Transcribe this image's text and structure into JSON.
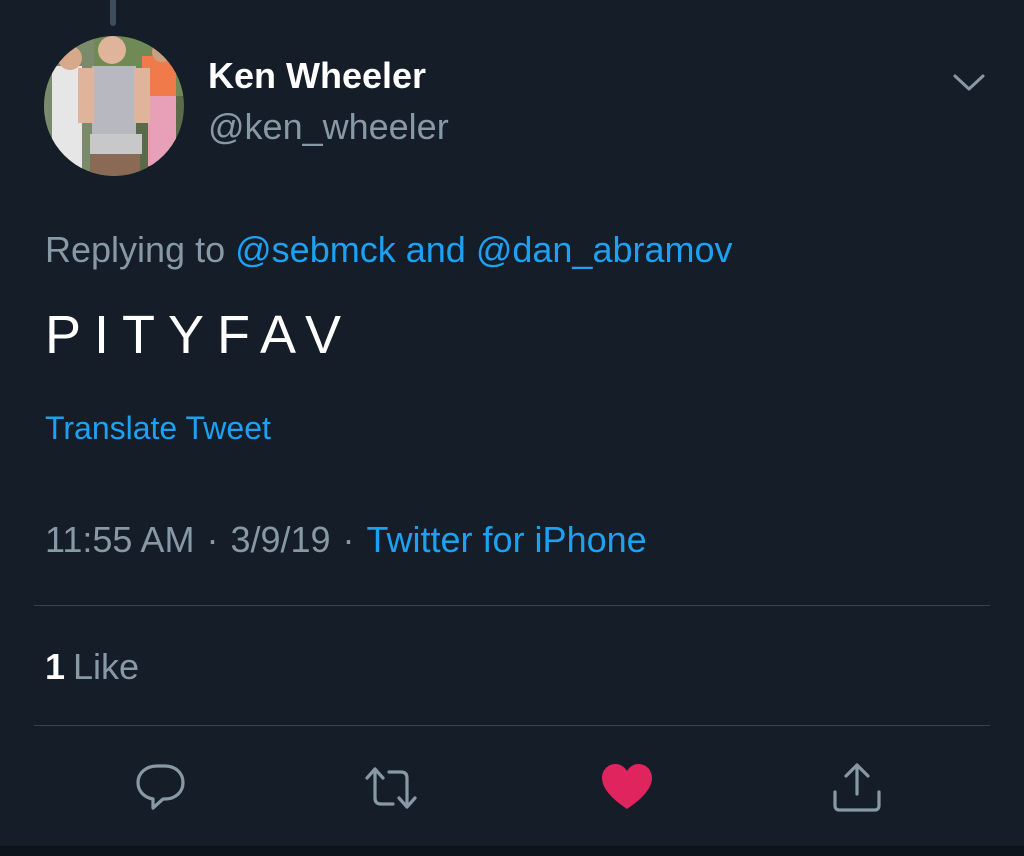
{
  "tweet": {
    "author": {
      "display_name": "Ken Wheeler",
      "handle": "@ken_wheeler"
    },
    "reply": {
      "prefix": "Replying to",
      "user1": "@sebmck",
      "conjunction": "and",
      "user2": "@dan_abramov"
    },
    "text": "PITYFAV",
    "translate_label": "Translate Tweet",
    "time": "11:55 AM",
    "separator": "·",
    "date": "3/9/19",
    "source": "Twitter for iPhone",
    "likes": {
      "count": "1",
      "label": "Like"
    }
  },
  "actions": {
    "reply_icon": "comment-icon",
    "retweet_icon": "retweet-icon",
    "like_icon": "heart-icon",
    "share_icon": "share-icon",
    "liked": true
  },
  "colors": {
    "background": "#151d28",
    "link": "#1da1f2",
    "secondary_text": "#8899a6",
    "like_active": "#e0245e",
    "divider": "#38444d"
  }
}
